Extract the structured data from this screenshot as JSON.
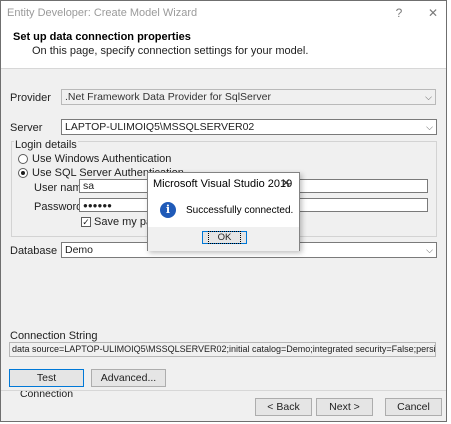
{
  "window": {
    "title": "Entity Developer: Create Model Wizard",
    "help_glyph": "?",
    "close_glyph": "✕"
  },
  "header": {
    "title": "Set up data connection properties",
    "subtitle": "On this page, specify connection settings for your model."
  },
  "provider": {
    "label": "Provider",
    "value": ".Net Framework Data Provider for SqlServer"
  },
  "server": {
    "label": "Server",
    "value": "LAPTOP-ULIMOIQ5\\MSSQLSERVER02"
  },
  "login": {
    "group_label": "Login details",
    "windows_auth_label": "Use Windows Authentication",
    "sql_auth_label": "Use SQL Server Authentication",
    "windows_auth_selected": false,
    "sql_auth_selected": true,
    "username_label": "User name",
    "username_value": "sa",
    "password_label": "Password",
    "password_value": "●●●●●●",
    "save_password_label": "Save my passw",
    "save_password_checked": true
  },
  "database": {
    "label": "Database",
    "value": "Demo"
  },
  "connection_string": {
    "label": "Connection String",
    "value": "data source=LAPTOP-ULIMOIQ5\\MSSQLSERVER02;initial catalog=Demo;integrated security=False;persist security info=True;"
  },
  "buttons": {
    "test_connection": "Test Connection",
    "advanced": "Advanced...",
    "back": "< Back",
    "next": "Next >",
    "cancel": "Cancel"
  },
  "message_box": {
    "title": "Microsoft Visual Studio 2019",
    "close_glyph": "✕",
    "icon_glyph": "i",
    "message": "Successfully connected.",
    "ok_label": "OK"
  },
  "colors": {
    "accent": "#0078d7",
    "info_icon": "#1f5ab8"
  }
}
